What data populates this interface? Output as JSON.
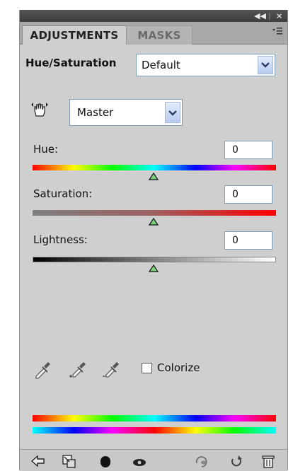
{
  "tabs": [
    {
      "label": "ADJUSTMENTS",
      "active": true
    },
    {
      "label": "MASKS",
      "active": false
    }
  ],
  "adjustment": {
    "name": "Hue/Saturation",
    "preset": "Default"
  },
  "channel": {
    "value": "Master"
  },
  "sliders": {
    "hue": {
      "label": "Hue:",
      "value": "0",
      "position": 0.5
    },
    "saturation": {
      "label": "Saturation:",
      "value": "0",
      "position": 0.5
    },
    "lightness": {
      "label": "Lightness:",
      "value": "0",
      "position": 0.5
    }
  },
  "colorize": {
    "label": "Colorize",
    "checked": false
  },
  "colors": {
    "panel": "#cfcfcf",
    "tab_bar": "#a8a8a8",
    "titlebar": "#474747",
    "thumb": "#5cb85c"
  },
  "icons": [
    "collapse-icon",
    "close-icon",
    "panel-menu-icon",
    "targeted-adjustment-hand-icon",
    "eyedropper-icon",
    "eyedropper-add-icon",
    "eyedropper-subtract-icon",
    "back-arrow-icon",
    "clip-to-layer-icon",
    "layer-mask-icon",
    "visibility-eye-icon",
    "previous-state-icon",
    "reset-icon",
    "trash-icon"
  ]
}
